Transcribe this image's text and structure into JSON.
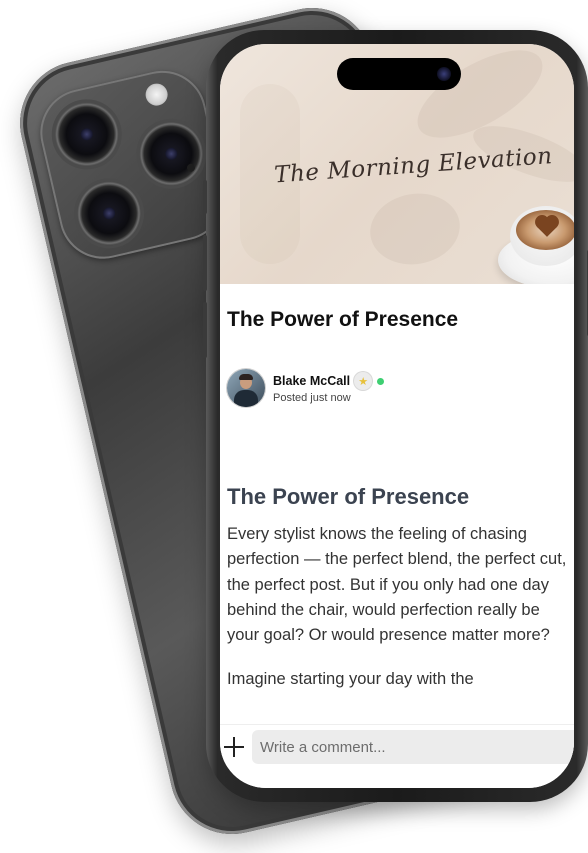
{
  "banner": {
    "title": "The Morning Elevation"
  },
  "post": {
    "title": "The Power of Presence",
    "author": {
      "name": "Blake McCall",
      "status": "Posted just now",
      "badge_icon": "star-badge-icon",
      "online_color": "#3ecf72"
    },
    "article_heading": "The Power of Presence",
    "paragraphs": [
      "Every stylist knows the feeling of chasing perfection — the perfect blend, the perfect cut, the perfect post. But if you only had one day behind the chair, would perfection really be your goal? Or would presence matter more?",
      "Imagine starting your day with the"
    ]
  },
  "comment": {
    "placeholder": "Write a comment..."
  }
}
